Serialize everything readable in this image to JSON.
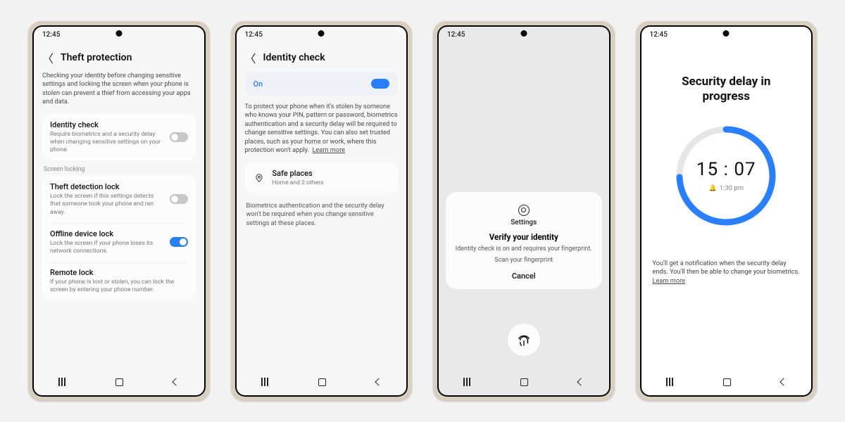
{
  "status_time": "12:45",
  "phone1": {
    "title": "Theft protection",
    "intro": "Checking your identity before changing sensitive settings and locking the screen when your phone is stolen can prevent a thief from accessing your apps and data.",
    "identity": {
      "title": "Identity check",
      "desc": "Require biometrics and a security delay when changing sensitive settings on your phone.",
      "on": false
    },
    "section_label": "Screen locking",
    "theft": {
      "title": "Theft detection lock",
      "desc": "Lock the screen if this settings detects that someone took your phone and ran away.",
      "on": false
    },
    "offline": {
      "title": "Offline device lock",
      "desc": "Lock the screen if your phone loses its network connections.",
      "on": true
    },
    "remote": {
      "title": "Remote lock",
      "desc": "If your phone is lost or stolen, you can lock the screen by entering your phone number."
    }
  },
  "phone2": {
    "title": "Identity check",
    "on_label": "On",
    "desc": "To protect your phone when it's stolen by someone who knows your PIN, pattern or password, biometrics authentication and a security delay will be required to change sensitive settings. You can also set trusted places, such as your home or work, where this protection won't apply.",
    "learn_more": "Learn more",
    "safe": {
      "title": "Safe places",
      "desc": "Home and 2 others"
    },
    "note": "Biometrics authentication and the security delay won't be required when you change sensitive settings at these places."
  },
  "phone3": {
    "app_name": "Settings",
    "title": "Verify your identity",
    "desc": "Identity check is on and requires your fingerprint.",
    "scan": "Scan your fingerprint",
    "cancel": "Cancel"
  },
  "phone4": {
    "title": "Security delay in progress",
    "timer": "15 : 07",
    "end_time": "1:30 pm",
    "note": "You'll get a notification when the security delay ends. You'll then be able to change your biometrics.",
    "learn_more": "Learn more"
  }
}
